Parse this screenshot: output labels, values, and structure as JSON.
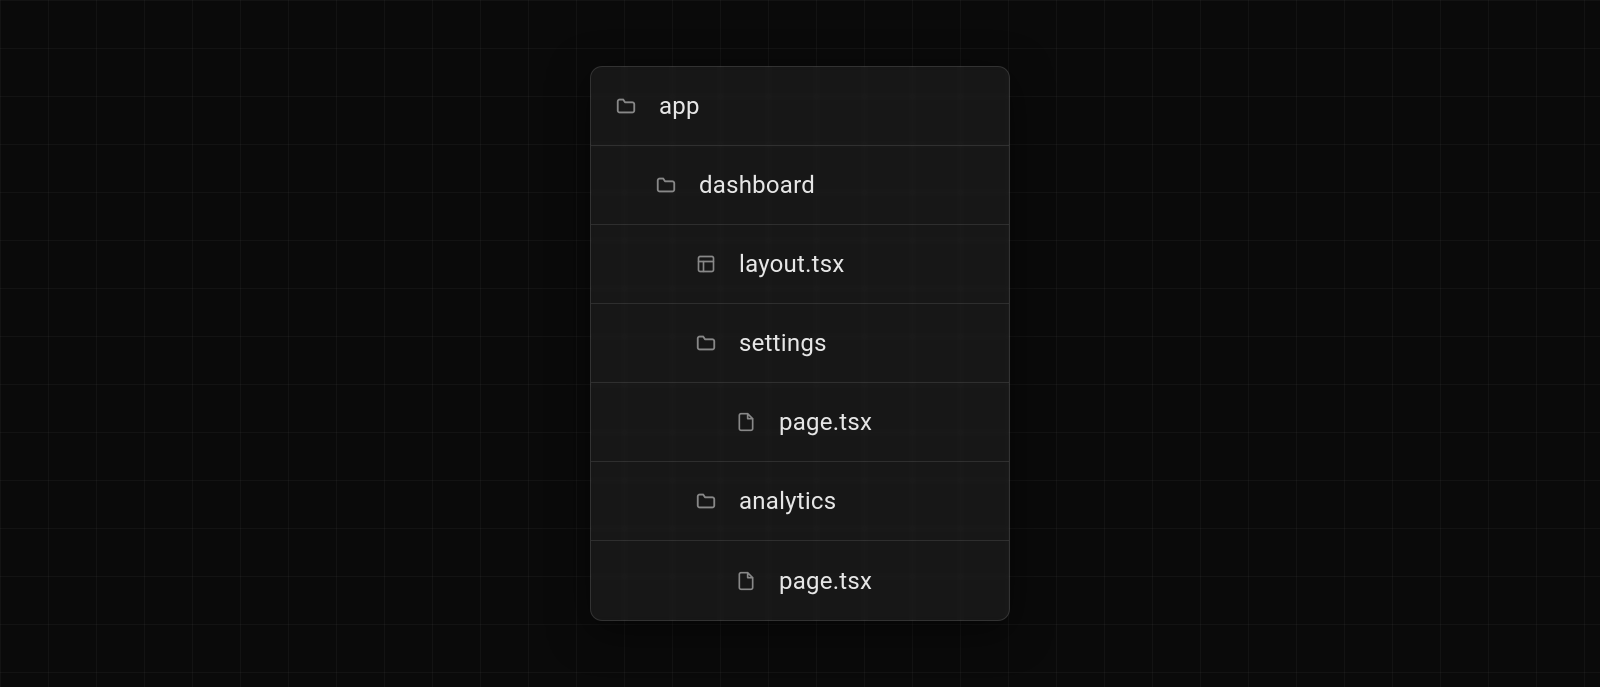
{
  "tree": {
    "items": [
      {
        "label": "app",
        "icon": "folder",
        "depth": 0
      },
      {
        "label": "dashboard",
        "icon": "folder",
        "depth": 1
      },
      {
        "label": "layout.tsx",
        "icon": "layout",
        "depth": 2
      },
      {
        "label": "settings",
        "icon": "folder",
        "depth": 2
      },
      {
        "label": "page.tsx",
        "icon": "file",
        "depth": 3
      },
      {
        "label": "analytics",
        "icon": "folder",
        "depth": 2
      },
      {
        "label": "page.tsx",
        "icon": "file",
        "depth": 3
      }
    ]
  }
}
